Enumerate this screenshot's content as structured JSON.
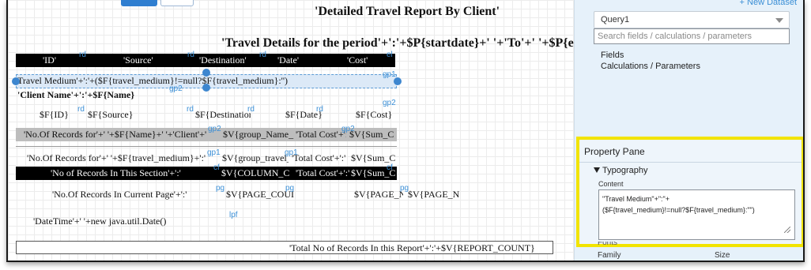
{
  "canvas": {
    "title": "'Detailed Travel Report By Client'",
    "subtitle": "'Travel Details for the period'+':'+$P{startdate}+' '+'To'+' '+$P{en",
    "header_cells": [
      "'ID'",
      "'Source'",
      "'Destination'",
      "'Date'",
      "'Cost'"
    ],
    "header_tags": [
      "rd",
      "rd",
      "rd",
      "el"
    ],
    "group_header_expr": "Travel Medium'+':'+($F{travel_medium}!=null?$F{travel_medium}:'')",
    "group_header_tag": "gp1",
    "group_header_tag2": "gp2",
    "client_name_expr": "'Client Name'+':'+$F{Name}",
    "detail_cells": [
      "$F{ID}",
      "$F{Source}",
      "$F{Destination",
      "$F{Date}",
      "$F{Cost}"
    ],
    "detail_tags": [
      "rd",
      "rd",
      "rd",
      "rd",
      "gp2"
    ],
    "gp2_footer": [
      "'No.Of Records for'+' '+$F{Name}+' '+'Client'+':'",
      "$V{group_Name_",
      "'Total Cost'+':'",
      "$V{Sum_C"
    ],
    "gp2_footer_tags": [
      "gp2",
      "gp2"
    ],
    "gp1_footer": [
      "'No.Of Records for'+' '+$F{travel_medium}+':'",
      "$V{group_travel_",
      "'Total Cost'+':'",
      "$V{Sum_C"
    ],
    "gp1_footer_tags": [
      "gp1",
      "gp1"
    ],
    "column_footer": [
      "'No of Records In This Section'+':'",
      "$V{COLUMN_C",
      "'Total Cost'+':'",
      "$V{Sum_C"
    ],
    "column_footer_tags": [
      "cf",
      "cf"
    ],
    "page_footer_label": "'No.Of Records In Current Page'+':'",
    "page_footer_cells": [
      "$V{PAGE_COUI",
      "$V{PAGE_N",
      "$V{PAGE_N"
    ],
    "page_footer_tags": [
      "pg",
      "pg",
      "pg"
    ],
    "last_page_expr": "'DateTime'+' '+new java.util.Date()",
    "last_page_tag": "lpf",
    "summary_expr": "'Total No of Records In this Report'+':'+$V{REPORT_COUNT}"
  },
  "dataset_panel": {
    "new_dataset_link": "+ New Dataset",
    "query_selected": "Query1",
    "search_placeholder": "Search fields / calculations / parameters",
    "tree_items": [
      "Fields",
      "Calculations / Parameters"
    ]
  },
  "property_pane": {
    "title": "Property Pane",
    "section": "Typography",
    "content_label": "Content",
    "content_value": "\"Travel Medium\"+\":\"+\n($F{travel_medium}!=null?$F{travel_medium}:\"\")",
    "font_heading": "Fonts",
    "family_label": "Family",
    "size_label": "Size"
  },
  "colors": {
    "selection_blue": "#3d86cf",
    "tag_blue": "#3b8fd6",
    "highlight_yellow": "#f2e400",
    "panel_bg": "#e6f1fa"
  }
}
